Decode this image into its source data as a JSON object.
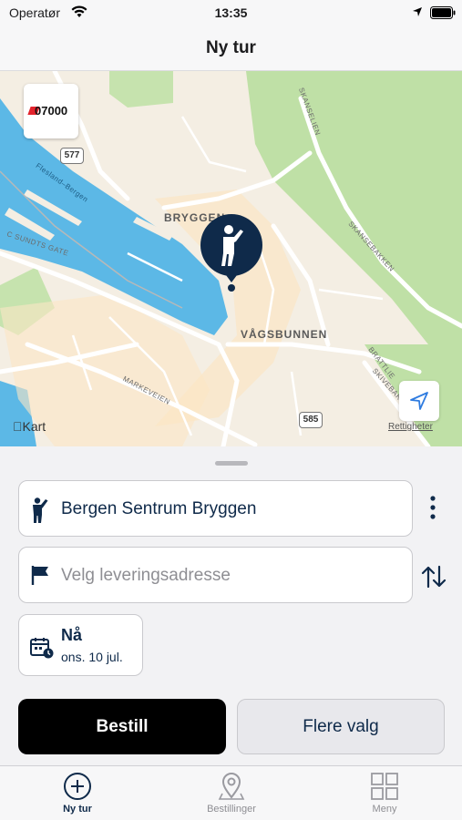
{
  "status_bar": {
    "carrier": "Operatør",
    "time": "13:35"
  },
  "nav": {
    "title": "Ny tur"
  },
  "map": {
    "logo_text": "07000",
    "labels": {
      "area_1": "BRYGGEN",
      "area_2": "VÅGSBUNNEN",
      "street_1": "C SUNDTS GATE",
      "street_2": "MARKEVEIEN",
      "street_3": "Flesland–Bergen",
      "street_4": "SKANSELIEN",
      "street_5": "SKANSEBAKKEN",
      "street_6": "BRATTLIE",
      "street_7": "SKIVEBAKKEN"
    },
    "shields": [
      "577",
      "585"
    ],
    "attribution": "Kart",
    "legal": "Rettigheter"
  },
  "sheet": {
    "pickup": "Bergen Sentrum Bryggen",
    "dropoff_placeholder": "Velg leveringsadresse",
    "time_label": "Nå",
    "time_date": "ons. 10 jul.",
    "order_button": "Bestill",
    "more_button": "Flere valg"
  },
  "tabs": [
    {
      "label": "Ny tur",
      "icon": "plus-circle-icon",
      "active": true
    },
    {
      "label": "Bestillinger",
      "icon": "map-pin-icon",
      "active": false
    },
    {
      "label": "Meny",
      "icon": "grid-icon",
      "active": false
    }
  ],
  "colors": {
    "accent": "#0f2a4a",
    "water": "#5cb8e6",
    "park": "#b9dca0"
  }
}
